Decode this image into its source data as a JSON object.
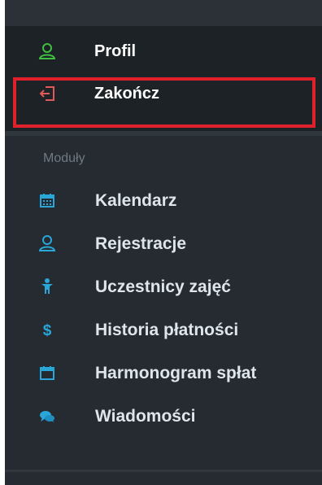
{
  "user_menu": {
    "items": [
      {
        "label": "Profil",
        "icon": "user-icon",
        "color": "#3fbf3f"
      },
      {
        "label": "Zakończ",
        "icon": "logout-icon",
        "color": "#e05a5a"
      }
    ]
  },
  "modules": {
    "title": "Moduły",
    "items": [
      {
        "label": "Kalendarz",
        "icon": "calendar-icon"
      },
      {
        "label": "Rejestracje",
        "icon": "user-register-icon"
      },
      {
        "label": "Uczestnicy zajęć",
        "icon": "participant-icon"
      },
      {
        "label": "Historia płatności",
        "icon": "dollar-icon"
      },
      {
        "label": "Harmonogram spłat",
        "icon": "schedule-icon"
      },
      {
        "label": "Wiadomości",
        "icon": "messages-icon"
      }
    ]
  },
  "colors": {
    "accent": "#2aa7d9",
    "highlight_border": "#e0202a",
    "panel_bg": "#252b31",
    "menu_bg": "#1c2226"
  }
}
